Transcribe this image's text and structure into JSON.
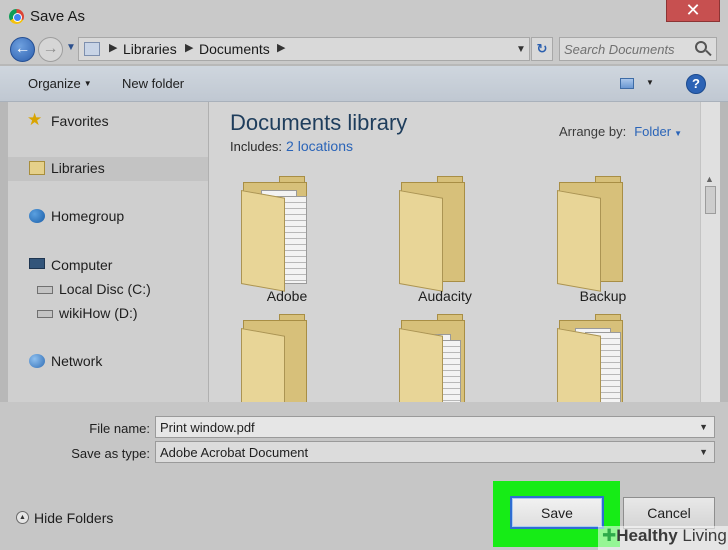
{
  "window": {
    "title": "Save As",
    "close_symbol": "✕"
  },
  "address": {
    "crumbs": [
      "Libraries",
      "Documents"
    ],
    "search_placeholder": "Search Documents"
  },
  "toolbar": {
    "organize": "Organize",
    "new_folder": "New folder",
    "help": "?"
  },
  "nav": {
    "favorites": "Favorites",
    "libraries": "Libraries",
    "homegroup": "Homegroup",
    "computer": "Computer",
    "local_disc": "Local Disc (C:)",
    "wikihow": "wikiHow (D:)",
    "network": "Network"
  },
  "content": {
    "title": "Documents library",
    "includes_label": "Includes:",
    "locations_link": "2 locations",
    "arrange_label": "Arrange by:",
    "arrange_value": "Folder",
    "folders": [
      "Adobe",
      "Audacity",
      "Backup"
    ]
  },
  "form": {
    "file_name_label": "File name:",
    "file_name_value": "Print window.pdf",
    "save_type_label": "Save as type:",
    "save_type_value": "Adobe Acrobat Document"
  },
  "footer": {
    "hide_folders": "Hide Folders",
    "save": "Save",
    "cancel": "Cancel"
  },
  "watermark": {
    "part1": "Healthy",
    "part2": "Living"
  },
  "colors": {
    "highlight": "#16ec16",
    "link": "#2a64b8",
    "title": "#1e3d5c"
  }
}
